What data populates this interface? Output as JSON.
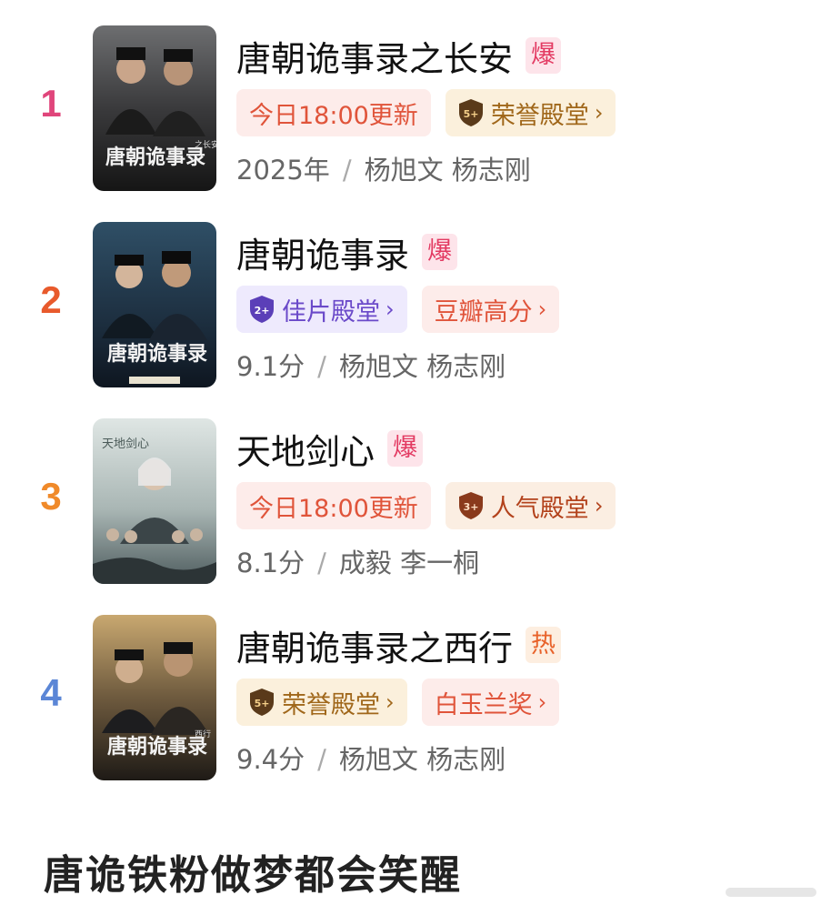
{
  "rankings": [
    {
      "rank": "1",
      "rank_color": "#e0457b",
      "title": "唐朝诡事录之长安",
      "badge": "爆",
      "tags": [
        {
          "label": "今日18:00更新",
          "style": "update"
        },
        {
          "label": "荣誉殿堂",
          "style": "gold",
          "icon": "shield-5-icon",
          "icon_text": "5+"
        }
      ],
      "meta_left": "2025年",
      "meta_sep": "/",
      "cast": "杨旭文 杨志刚",
      "poster_text": "唐朝诡事录",
      "poster_sub": "之长安"
    },
    {
      "rank": "2",
      "rank_color": "#e85a2c",
      "title": "唐朝诡事录",
      "badge": "爆",
      "tags": [
        {
          "label": "佳片殿堂",
          "style": "purple",
          "icon": "shield-2-icon",
          "icon_text": "2+"
        },
        {
          "label": "豆瓣高分",
          "style": "red"
        }
      ],
      "meta_left": "9.1分",
      "meta_sep": "/",
      "cast": "杨旭文 杨志刚",
      "poster_text": "唐朝诡事录",
      "poster_sub": ""
    },
    {
      "rank": "3",
      "rank_color": "#f08a2a",
      "title": "天地剑心",
      "badge": "爆",
      "tags": [
        {
          "label": "今日18:00更新",
          "style": "update"
        },
        {
          "label": "人气殿堂",
          "style": "brown",
          "icon": "shield-3-icon",
          "icon_text": "3+"
        }
      ],
      "meta_left": "8.1分",
      "meta_sep": "/",
      "cast": "成毅 李一桐",
      "poster_text": "天地剑心",
      "poster_sub": ""
    },
    {
      "rank": "4",
      "rank_color": "#5b86d6",
      "title": "唐朝诡事录之西行",
      "badge": "热",
      "tags": [
        {
          "label": "荣誉殿堂",
          "style": "gold",
          "icon": "shield-5-icon",
          "icon_text": "5+"
        },
        {
          "label": "白玉兰奖",
          "style": "red"
        }
      ],
      "meta_left": "9.4分",
      "meta_sep": "/",
      "cast": "杨旭文 杨志刚",
      "poster_text": "唐朝诡事录",
      "poster_sub": "西行"
    }
  ],
  "chevron": "›",
  "footer_text": "唐诡铁粉做梦都会笑醒",
  "colors": {
    "hot_badge": "#e33a62",
    "warm_badge": "#e8622a",
    "update_tag": "#e0543a",
    "gold_tag": "#a0671a",
    "purple_tag": "#6a49c9"
  }
}
